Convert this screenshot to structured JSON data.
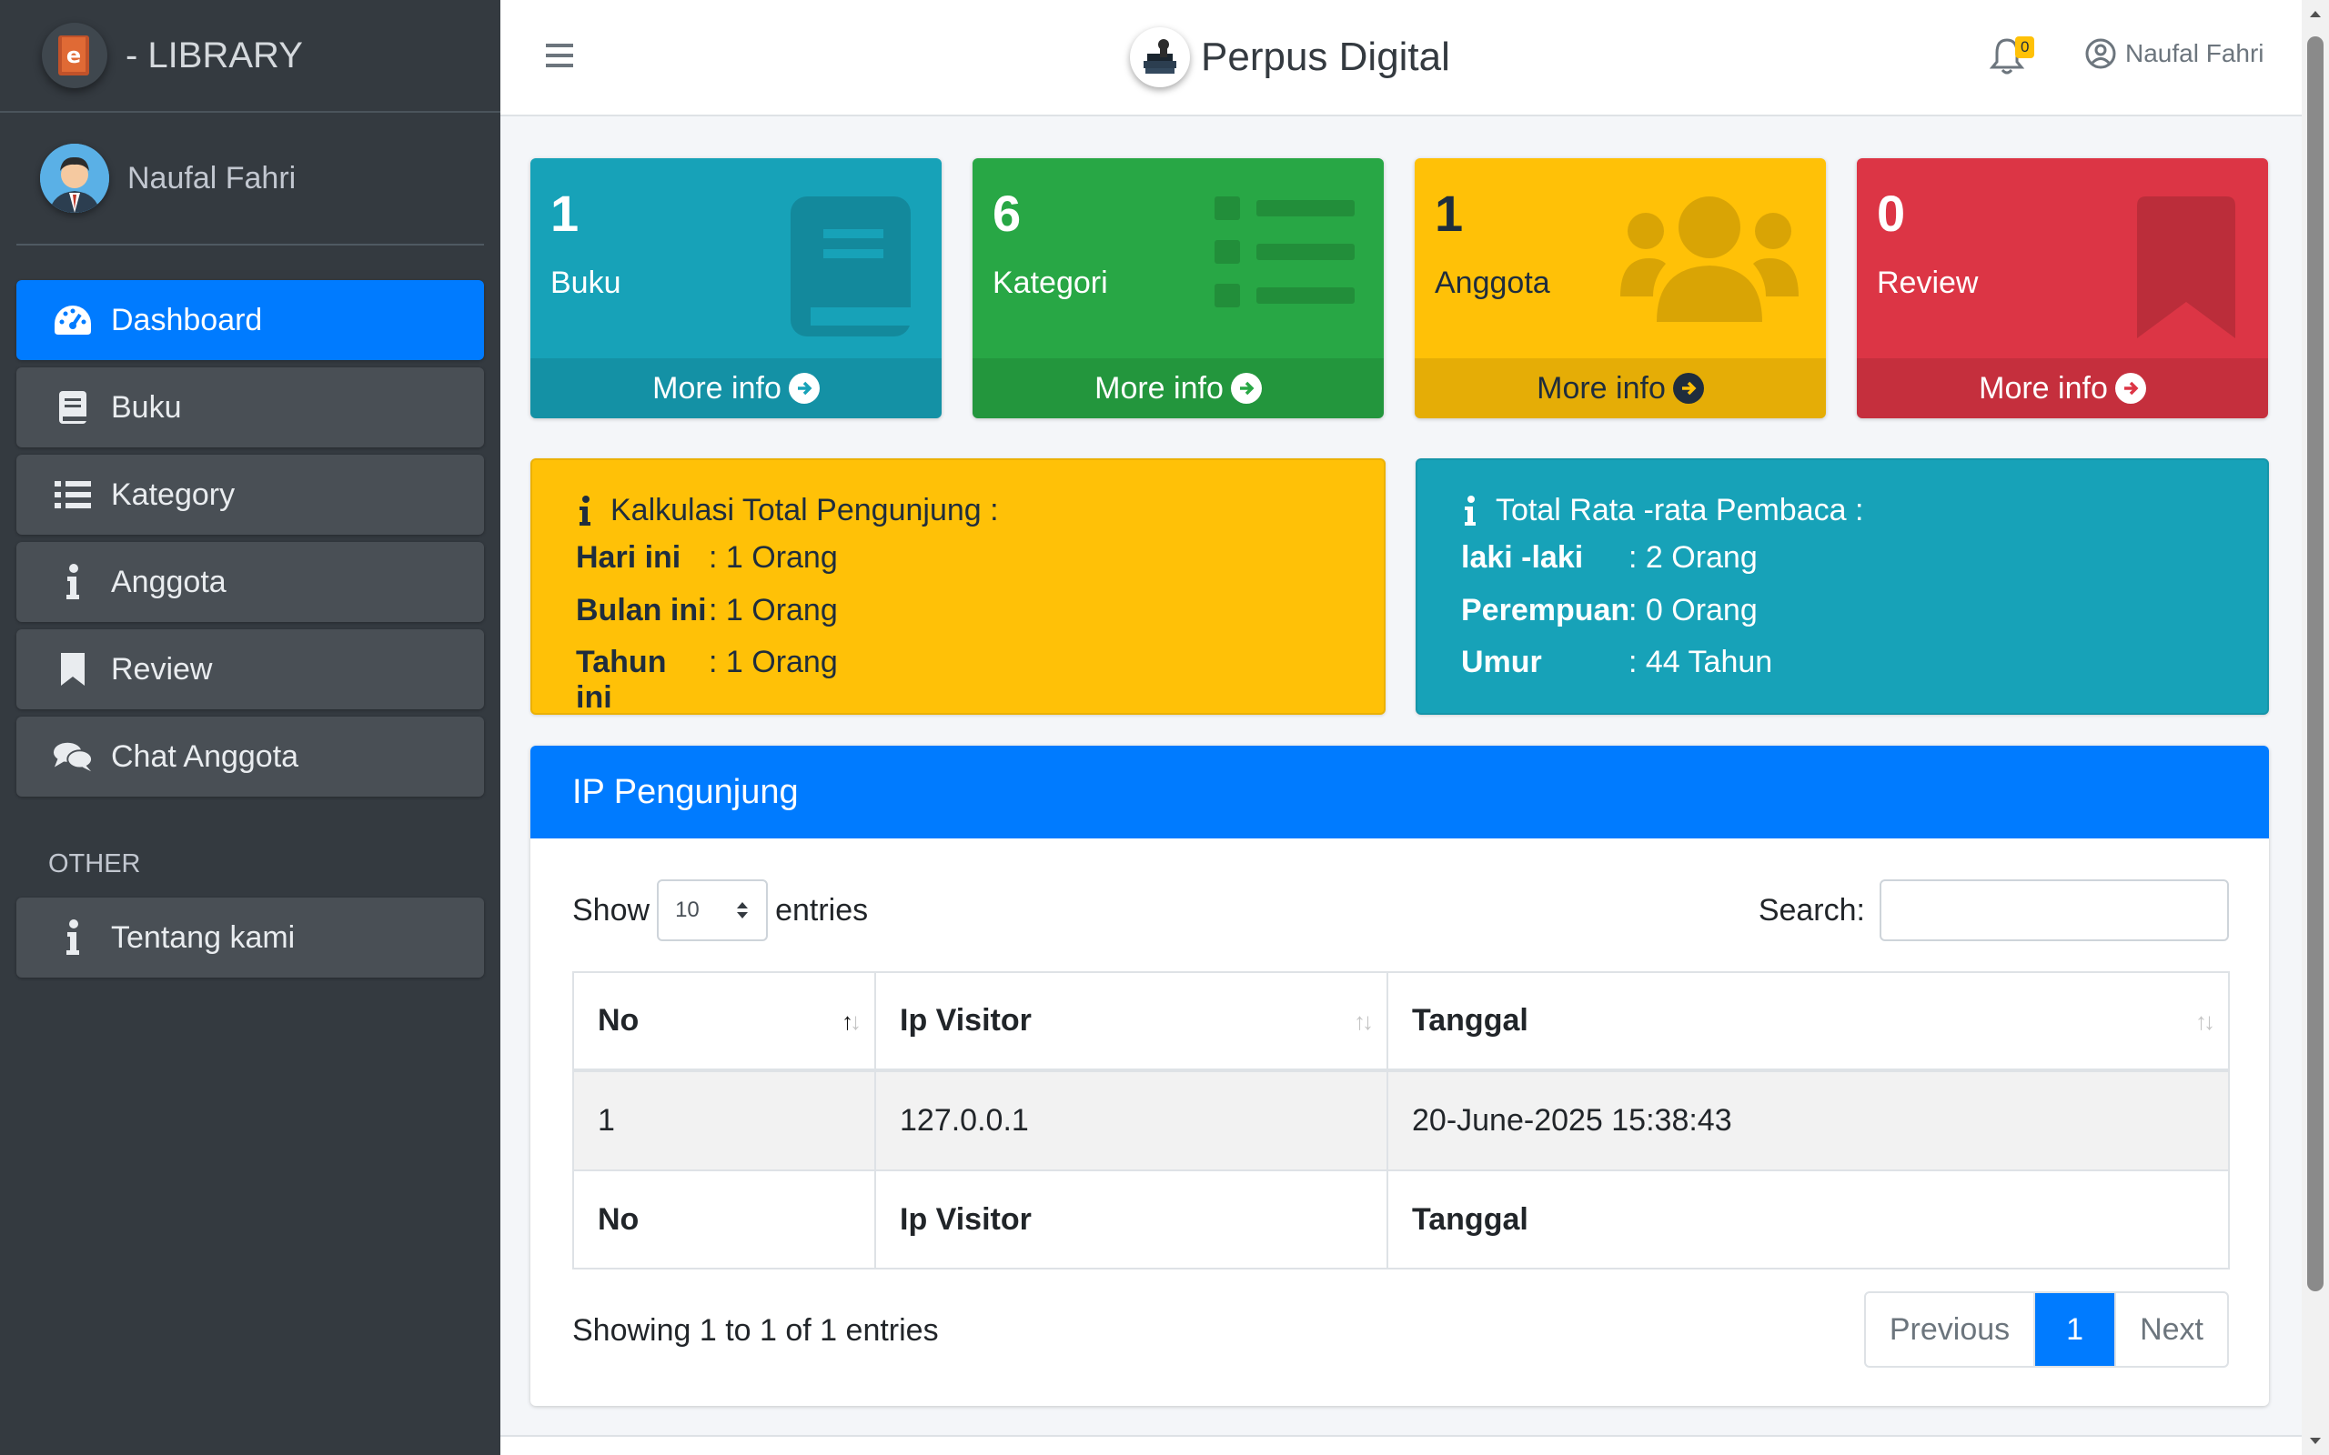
{
  "brand": {
    "name": "- LIBRARY"
  },
  "user": {
    "name": "Naufal Fahri"
  },
  "sidebar": {
    "items": [
      {
        "label": "Dashboard",
        "icon": "tachometer-icon"
      },
      {
        "label": "Buku",
        "icon": "book-icon"
      },
      {
        "label": "Kategory",
        "icon": "list-icon"
      },
      {
        "label": "Anggota",
        "icon": "info-icon"
      },
      {
        "label": "Review",
        "icon": "bookmark-icon"
      },
      {
        "label": "Chat Anggota",
        "icon": "comments-icon"
      }
    ],
    "other_header": "OTHER",
    "other_items": [
      {
        "label": "Tentang kami",
        "icon": "info-icon"
      }
    ]
  },
  "topbar": {
    "title": "Perpus Digital",
    "notif_count": "0",
    "profile_name": "Naufal Fahri"
  },
  "stats": [
    {
      "value": "1",
      "label": "Buku",
      "more": "More info",
      "color": "#17a2b8"
    },
    {
      "value": "6",
      "label": "Kategori",
      "more": "More info",
      "color": "#28a745"
    },
    {
      "value": "1",
      "label": "Anggota",
      "more": "More info",
      "color": "#ffc107"
    },
    {
      "value": "0",
      "label": "Review",
      "more": "More info",
      "color": "#dc3545"
    }
  ],
  "visitors": {
    "title": "Kalkulasi Total Pengunjung :",
    "rows": [
      {
        "label": "Hari ini",
        "value": ": 1 Orang"
      },
      {
        "label": "Bulan ini",
        "value": ": 1 Orang"
      },
      {
        "label": "Tahun ini",
        "value": ": 1 Orang"
      }
    ]
  },
  "readers": {
    "title": "Total Rata -rata Pembaca :",
    "rows": [
      {
        "label": "laki -laki",
        "value": ": 2 Orang"
      },
      {
        "label": "Perempuan",
        "value": ": 0 Orang"
      },
      {
        "label": "Umur",
        "value": ": 44 Tahun"
      }
    ]
  },
  "ip_table": {
    "title": "IP Pengunjung",
    "show_label": "Show",
    "entries_value": "10",
    "entries_label": "entries",
    "search_label": "Search:",
    "search_value": "",
    "columns": [
      "No",
      "Ip Visitor",
      "Tanggal"
    ],
    "rows": [
      [
        "1",
        "127.0.0.1",
        "20-June-2025 15:38:43"
      ]
    ],
    "info": "Showing 1 to 1 of 1 entries",
    "pagination": {
      "prev": "Previous",
      "current": "1",
      "next": "Next"
    }
  },
  "colors": {
    "primary": "#007bff",
    "sidebar": "#343a40",
    "info": "#17a2b8",
    "success": "#28a745",
    "warning": "#ffc107",
    "danger": "#dc3545"
  }
}
